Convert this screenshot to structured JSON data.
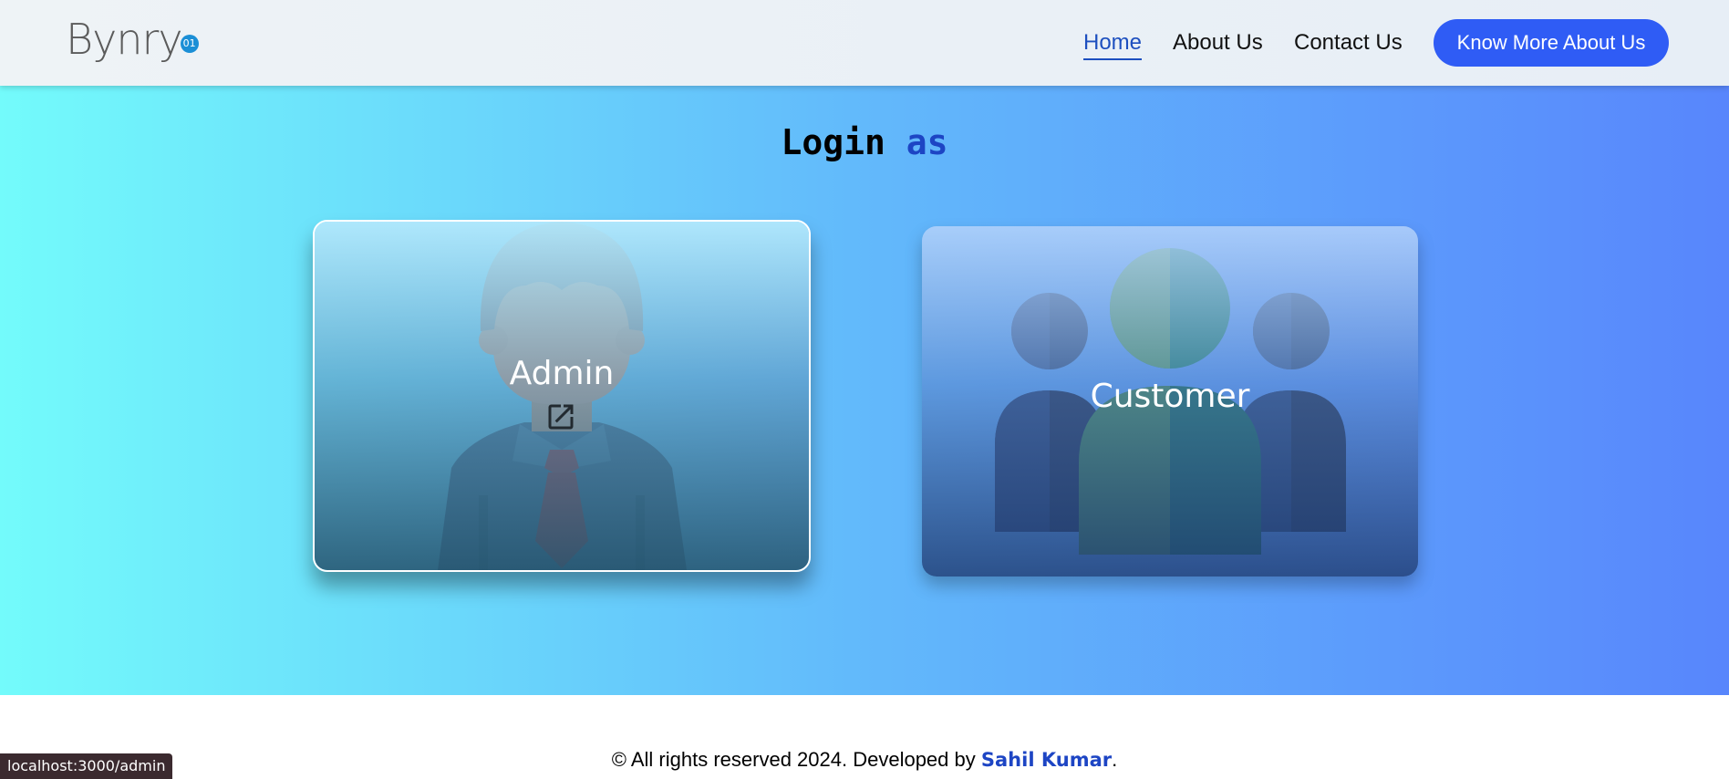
{
  "brand": {
    "logo_text": "Bynry",
    "logo_badge": "01"
  },
  "nav": {
    "items": [
      {
        "label": "Home",
        "active": true
      },
      {
        "label": "About Us",
        "active": false
      },
      {
        "label": "Contact Us",
        "active": false
      }
    ],
    "cta_label": "Know More About Us"
  },
  "hero": {
    "title_part1": "Login",
    "title_part2": "as",
    "cards": [
      {
        "label": "Admin",
        "icon": "external-link-icon",
        "image": "businessman-avatar"
      },
      {
        "label": "Customer",
        "image": "users-group"
      }
    ]
  },
  "footer": {
    "text_prefix": "© All rights reserved 2024. Developed by",
    "author": "Sahil Kumar",
    "text_suffix": "."
  },
  "status_bar": {
    "url": "localhost:3000/admin"
  },
  "colors": {
    "accent": "#1d45c4",
    "cta_bg": "#2f5cf5",
    "hero_gradient_start": "#73fbfb",
    "hero_gradient_end": "#5886fc"
  }
}
